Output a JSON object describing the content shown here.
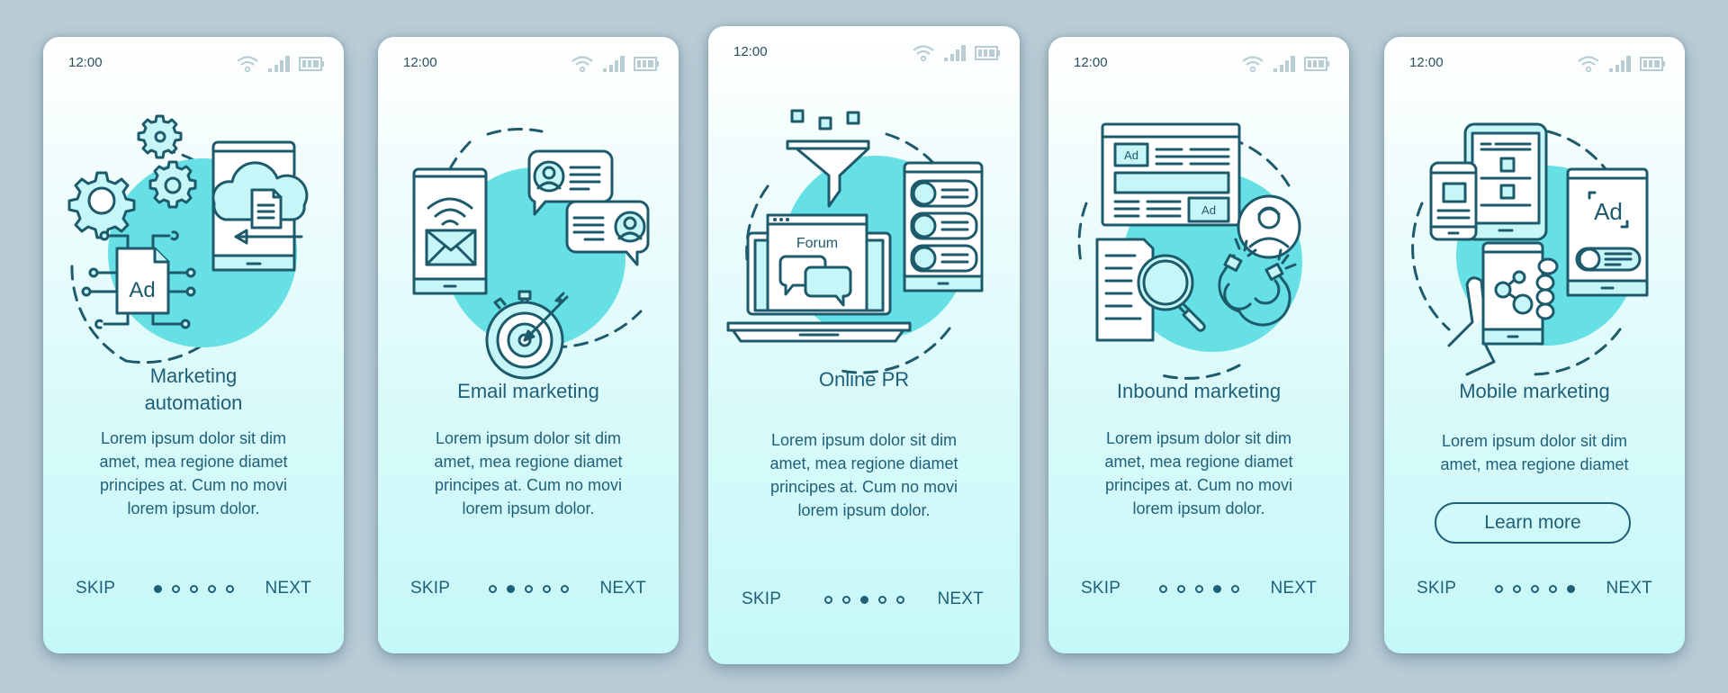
{
  "colors": {
    "background": "#b9cdd7",
    "text": "#1f5f78",
    "icon_stroke": "#1d5a6b",
    "accent_blob": "#66e0e4",
    "status_icons": "#b8ccd4"
  },
  "status_bar": {
    "time": "12:00",
    "icons": [
      "wifi-icon",
      "signal-icon",
      "battery-icon"
    ]
  },
  "nav": {
    "skip_label": "SKIP",
    "next_label": "NEXT",
    "total_pages": 5
  },
  "screens": [
    {
      "illustration": "marketing-automation-illustration",
      "title": "Marketing automation",
      "title_lines": [
        "Marketing",
        "automation"
      ],
      "description_lines": [
        "Lorem ipsum dolor sit dim",
        "amet, mea regione diamet",
        "principes at. Cum no movi",
        "lorem ipsum dolor."
      ],
      "active_page": 1
    },
    {
      "illustration": "email-marketing-illustration",
      "title": "Email marketing",
      "description_lines": [
        "Lorem ipsum dolor sit dim",
        "amet, mea regione diamet",
        "principes at. Cum no movi",
        "lorem ipsum dolor."
      ],
      "active_page": 2
    },
    {
      "illustration": "online-pr-illustration",
      "title": "Online PR",
      "forum_label": "Forum",
      "description_lines": [
        "Lorem ipsum dolor sit dim",
        "amet, mea regione diamet",
        "principes at. Cum no movi",
        "lorem ipsum dolor."
      ],
      "active_page": 3
    },
    {
      "illustration": "inbound-marketing-illustration",
      "title": "Inbound marketing",
      "ad_label": "Ad",
      "description_lines": [
        "Lorem ipsum dolor sit dim",
        "amet, mea regione diamet",
        "principes at. Cum no movi",
        "lorem ipsum dolor."
      ],
      "active_page": 4
    },
    {
      "illustration": "mobile-marketing-illustration",
      "title": "Mobile marketing",
      "ad_label": "Ad",
      "description_lines": [
        "Lorem ipsum dolor sit dim",
        "amet, mea regione diamet"
      ],
      "button_label": "Learn more",
      "active_page": 5
    }
  ],
  "labels": {
    "ad": "Ad",
    "forum": "Forum"
  }
}
